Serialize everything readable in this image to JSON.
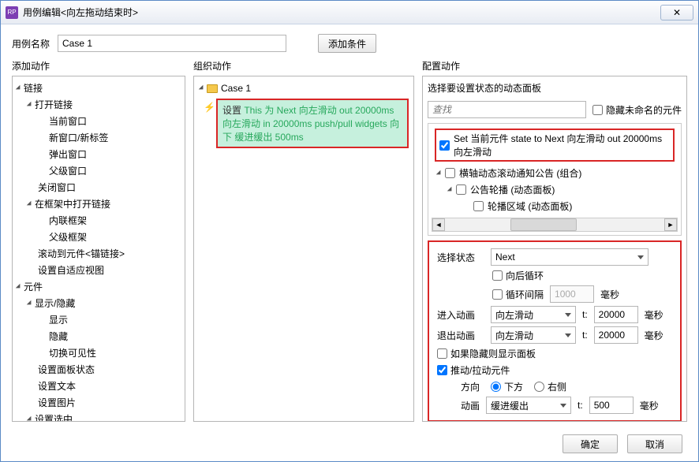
{
  "window": {
    "title": "用例编辑<向左拖动结束时>",
    "closeGlyph": "✕"
  },
  "caseName": {
    "label": "用例名称",
    "value": "Case 1"
  },
  "addCondition": "添加条件",
  "leftPanel": {
    "title": "添加动作",
    "items": [
      {
        "t": "链接",
        "d": 0,
        "open": true
      },
      {
        "t": "打开链接",
        "d": 1,
        "open": true
      },
      {
        "t": "当前窗口",
        "d": 2
      },
      {
        "t": "新窗口/新标签",
        "d": 2
      },
      {
        "t": "弹出窗口",
        "d": 2
      },
      {
        "t": "父级窗口",
        "d": 2
      },
      {
        "t": "关闭窗口",
        "d": 1
      },
      {
        "t": "在框架中打开链接",
        "d": 1,
        "open": true
      },
      {
        "t": "内联框架",
        "d": 2
      },
      {
        "t": "父级框架",
        "d": 2
      },
      {
        "t": "滚动到元件<锚链接>",
        "d": 1
      },
      {
        "t": "设置自适应视图",
        "d": 1
      },
      {
        "t": "元件",
        "d": 0,
        "open": true
      },
      {
        "t": "显示/隐藏",
        "d": 1,
        "open": true
      },
      {
        "t": "显示",
        "d": 2
      },
      {
        "t": "隐藏",
        "d": 2
      },
      {
        "t": "切换可见性",
        "d": 2
      },
      {
        "t": "设置面板状态",
        "d": 1
      },
      {
        "t": "设置文本",
        "d": 1
      },
      {
        "t": "设置图片",
        "d": 1
      },
      {
        "t": "设置选中",
        "d": 1,
        "open": true
      }
    ]
  },
  "midPanel": {
    "title": "组织动作",
    "caseLabel": "Case 1",
    "actionPrefix": "设置 ",
    "actionGreen1": "This 为 Next 向左滑动 out 20000ms 向左滑动 in 20000ms push/pull widgets 向下 缓进缓出 500ms"
  },
  "rightPanel": {
    "title": "配置动作",
    "section1": "选择要设置状态的动态面板",
    "searchPlaceholder": "查找",
    "hideUnnamed": "隐藏未命名的元件",
    "setPrefix": "Set 当前元件 state to ",
    "setGreen": "Next 向左滑动 out 20000ms 向左滑动",
    "dyn1": "横轴动态滚动通知公告 (组合)",
    "dyn2": "公告轮播 (动态面板)",
    "dyn3": "轮播区域 (动态面板)",
    "stateLabel": "选择状态",
    "stateValue": "Next",
    "loopBack": "向后循环",
    "loopInterval": "循环间隔",
    "loopIntervalVal": "1000",
    "ms": "毫秒",
    "animateIn": "进入动画",
    "animateOut": "退出动画",
    "slideLeft": "向左滑动",
    "t": "t:",
    "tVal": "20000",
    "showIfHidden": "如果隐藏则显示面板",
    "pushPull": "推动/拉动元件",
    "dirLabel": "方向",
    "dirBelow": "下方",
    "dirRight": "右侧",
    "animLabel": "动画",
    "easeInOut": "缓进缓出",
    "animT": "500"
  },
  "footer": {
    "ok": "确定",
    "cancel": "取消"
  }
}
